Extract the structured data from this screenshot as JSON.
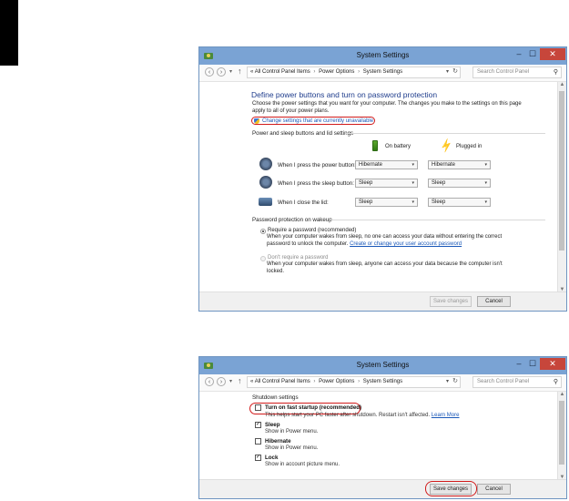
{
  "window1": {
    "title": "System Settings",
    "breadcrumb": {
      "prefix": "«",
      "items": [
        "All Control Panel Items",
        "Power Options",
        "System Settings"
      ]
    },
    "search_placeholder": "Search Control Panel",
    "heading": "Define power buttons and turn on password protection",
    "intro": "Choose the power settings that you want for your computer. The changes you make to the settings on this page apply to all of your power plans.",
    "change_link": "Change settings that are currently unavailable",
    "section_power": "Power and sleep buttons and lid settings",
    "col_battery": "On battery",
    "col_plugged": "Plugged in",
    "rows": [
      {
        "label": "When I press the power button:",
        "battery": "Hibernate",
        "plugged": "Hibernate"
      },
      {
        "label": "When I press the sleep button:",
        "battery": "Sleep",
        "plugged": "Sleep"
      },
      {
        "label": "When I close the lid:",
        "battery": "Sleep",
        "plugged": "Sleep"
      }
    ],
    "section_password": "Password protection on wakeup",
    "opt_require_label": "Require a password (recommended)",
    "opt_require_desc1": "When your computer wakes from sleep, no one can access your data without entering the correct",
    "opt_require_desc2": "password to unlock the computer.",
    "opt_require_link": "Create or change your user account password",
    "opt_none_label": "Don't require a password",
    "opt_none_desc1": "When your computer wakes from sleep, anyone can access your data because the computer isn't",
    "opt_none_desc2": "locked.",
    "save_label": "Save changes",
    "cancel_label": "Cancel"
  },
  "window2": {
    "title": "System Settings",
    "breadcrumb": {
      "prefix": "«",
      "items": [
        "All Control Panel Items",
        "Power Options",
        "System Settings"
      ]
    },
    "search_placeholder": "Search Control Panel",
    "section_shutdown": "Shutdown settings",
    "fast_startup_label": "Turn on fast startup (recommended)",
    "fast_startup_desc": "This helps start your PC faster after shutdown. Restart isn't affected.",
    "fast_startup_link": "Learn More",
    "items": [
      {
        "label": "Sleep",
        "desc": "Show in Power menu.",
        "checked": "✓"
      },
      {
        "label": "Hibernate",
        "desc": "Show in Power menu.",
        "checked": ""
      },
      {
        "label": "Lock",
        "desc": "Show in account picture menu.",
        "checked": "✓"
      }
    ],
    "save_label": "Save changes",
    "cancel_label": "Cancel"
  },
  "glyphs": {
    "min": "–",
    "max": "☐",
    "close": "✕",
    "back": "‹",
    "fwd": "›",
    "dd": "▾",
    "up": "↑",
    "sep": "›",
    "refresh": "↻",
    "search": "⚲",
    "caret": "▾",
    "scroll_up": "▲",
    "scroll_down": "▼",
    "plug": "⚡"
  }
}
